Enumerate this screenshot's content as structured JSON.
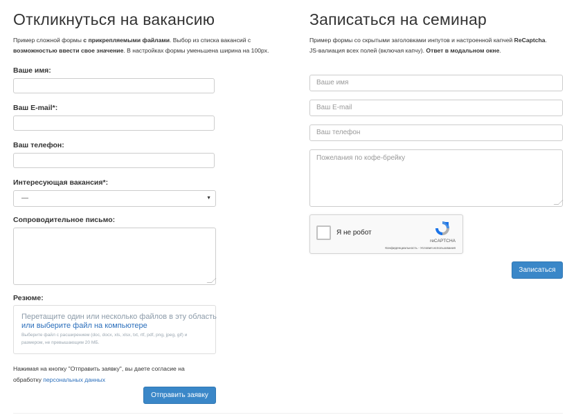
{
  "left": {
    "title": "Откликнуться на вакансию",
    "desc": {
      "p1": "Пример сложной формы ",
      "b1": "с прикрепляемыми файлами",
      "p2": ". Выбор из списка вакансий с",
      "b2": "возможностью ввести свое значение",
      "p3": ". В настройках формы уменьшена ширина на 100px."
    },
    "name_label": "Ваше имя:",
    "email_label": "Ваш E-mail*:",
    "phone_label": "Ваш телефон:",
    "vacancy_label": "Интересующая вакансия*:",
    "vacancy_value": "—",
    "letter_label": "Сопроводительное письмо:",
    "resume_label": "Резюме:",
    "drop": {
      "line1": "Перетащите один или несколько файлов в эту область",
      "link": "или выберите файл на компьютере",
      "hint": "Выберите файл с расширением (doc, docx, xls, xlsx, txt, rtf, pdf, png, jpeg, gif) и размером, не превышающим 20 МБ."
    },
    "agree": {
      "line1": "Нажимая на кнопку \"Отправить заявку\", вы даете согласие на",
      "line2": "обработку ",
      "link": "персональных данных"
    },
    "submit": "Отправить заявку"
  },
  "right": {
    "title": "Записаться на семинар",
    "desc": {
      "p1": "Пример формы со скрытыми заголовками инпутов и настроенной капчей ",
      "b1": "ReCaptcha",
      "p2": ".",
      "p3": "JS-валиация всех полей (включая капчу). ",
      "b2": "Ответ в модальном окне",
      "p4": "."
    },
    "name_placeholder": "Ваше имя",
    "email_placeholder": "Ваш E-mail",
    "phone_placeholder": "Ваш телефон",
    "wishes_placeholder": "Пожелания по кофе-брейку",
    "captcha": {
      "label": "Я не робот",
      "brand": "reCAPTCHA",
      "links": "Конфиденциальность - Условия использования"
    },
    "submit": "Записаться"
  },
  "colors": {
    "button": "#3a87c8",
    "link": "#2a6ebb"
  }
}
